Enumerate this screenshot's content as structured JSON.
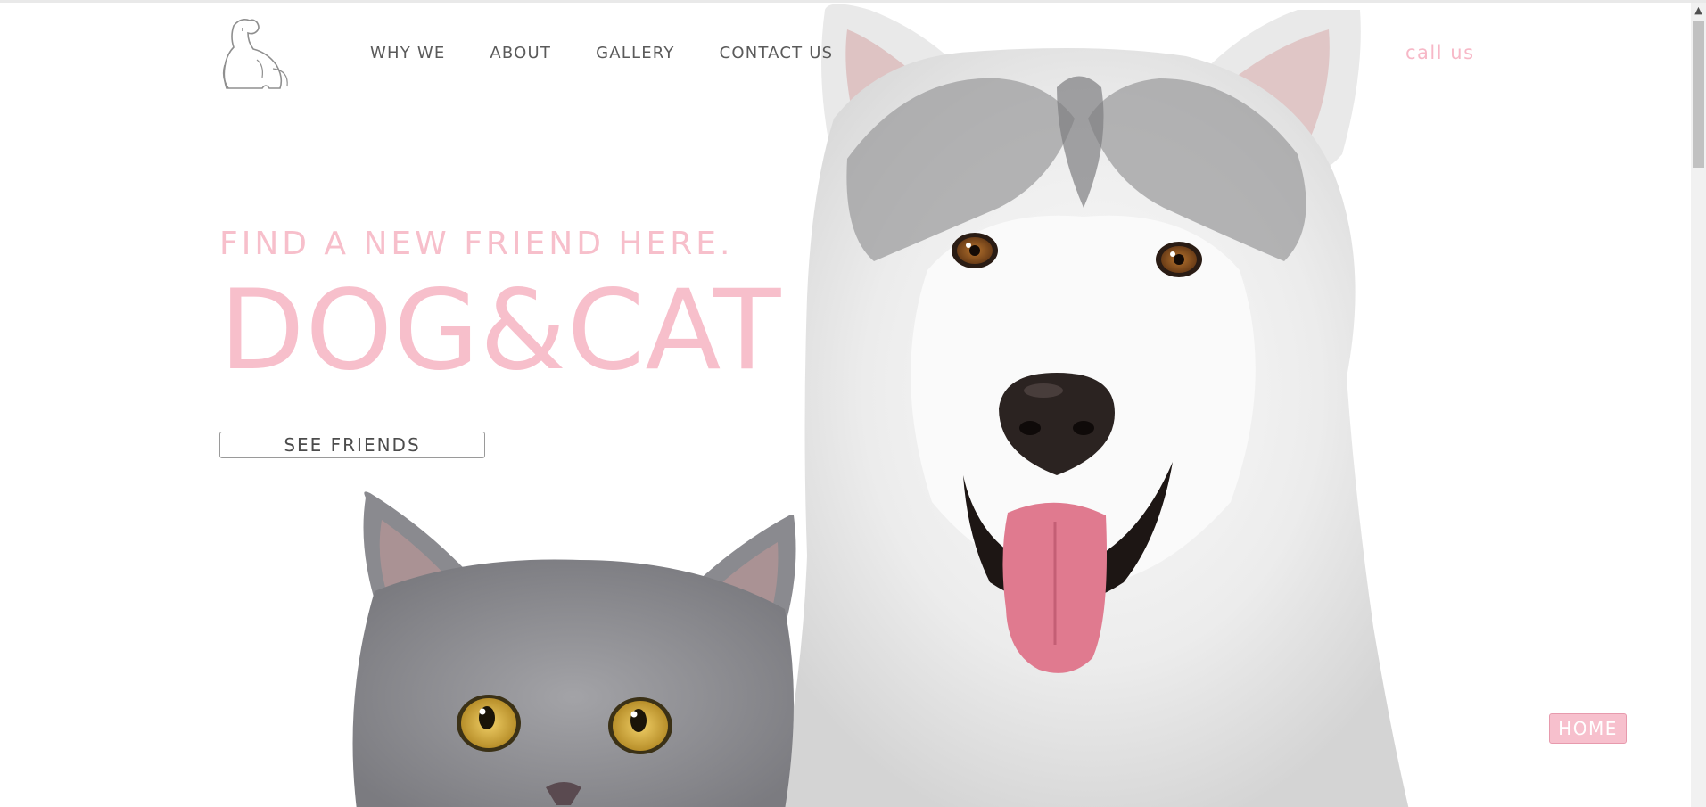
{
  "nav": {
    "items": [
      "WHY WE",
      "ABOUT",
      "GALLERY",
      "CONTACT US"
    ],
    "call_label": "call us"
  },
  "hero": {
    "tagline": "FIND A NEW FRIEND HERE.",
    "brand": "DOG&CAT",
    "cta_label": "SEE FRIENDS"
  },
  "home_label": "HOME",
  "colors": {
    "accent_pink": "#f7bfcb",
    "nav_text": "#5a5a5a",
    "cat_fur": "#8e8e92",
    "dog_fur": "#e6e6e6",
    "tongue": "#e06f87"
  },
  "icons": {
    "logo": "dog-cat-logo-icon",
    "scroll_up": "chevron-up-icon"
  }
}
